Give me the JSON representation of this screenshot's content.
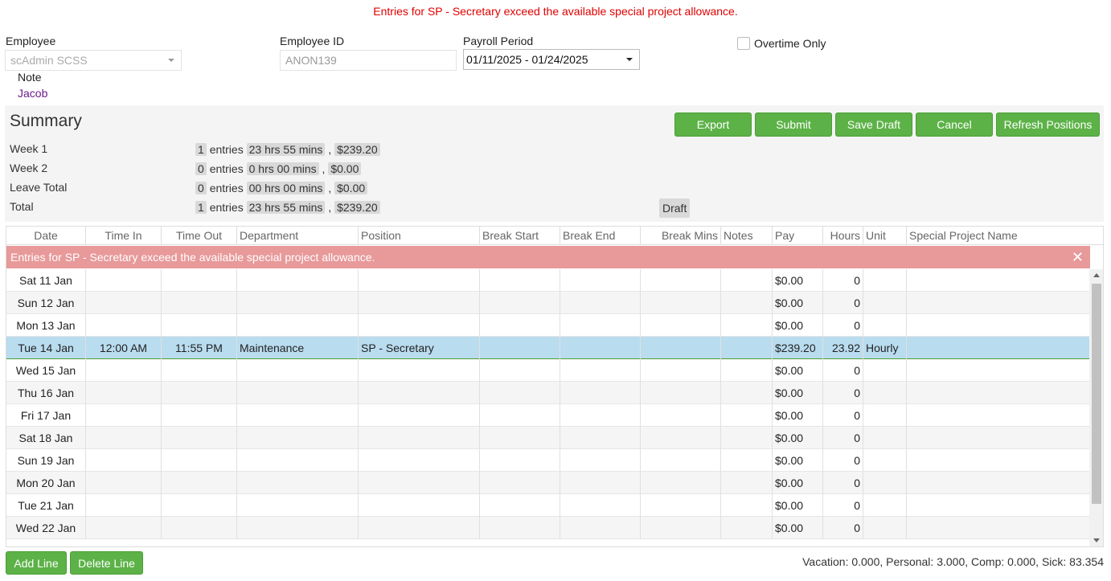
{
  "error_message": "Entries for SP - Secretary exceed the available special project allowance.",
  "form": {
    "employee_label": "Employee",
    "employee_value": "scAdmin SCSS",
    "employee_id_label": "Employee ID",
    "employee_id_value": "ANON139",
    "payroll_label": "Payroll Period",
    "payroll_value": "01/11/2025 - 01/24/2025",
    "overtime_label": "Overtime Only",
    "note_label": "Note",
    "note_value": "Jacob"
  },
  "summary": {
    "title": "Summary",
    "buttons": [
      "Export",
      "Submit",
      "Save Draft",
      "Cancel",
      "Refresh Positions"
    ],
    "rows": [
      {
        "label": "Week 1",
        "entries": "1",
        "entries_word": "entries",
        "hours": "23 hrs 55 mins",
        "amount": "$239.20"
      },
      {
        "label": "Week 2",
        "entries": "0",
        "entries_word": "entries",
        "hours": "0 hrs 00 mins",
        "amount": "$0.00"
      },
      {
        "label": "Leave Total",
        "entries": "0",
        "entries_word": "entries",
        "hours": "00 hrs 00 mins",
        "amount": "$0.00"
      },
      {
        "label": "Total",
        "entries": "1",
        "entries_word": "entries",
        "hours": "23 hrs 55 mins",
        "amount": "$239.20"
      }
    ],
    "status": "Draft"
  },
  "grid": {
    "columns": [
      "Date",
      "Time In",
      "Time Out",
      "Department",
      "Position",
      "Break Start",
      "Break End",
      "Break Mins",
      "Notes",
      "Pay",
      "Hours",
      "Unit",
      "Special Project Name"
    ],
    "rows": [
      {
        "date": "Sat 11 Jan",
        "time_in": "",
        "time_out": "",
        "department": "",
        "position": "",
        "pay": "$0.00",
        "hours": "0",
        "unit": ""
      },
      {
        "date": "Sun 12 Jan",
        "time_in": "",
        "time_out": "",
        "department": "",
        "position": "",
        "pay": "$0.00",
        "hours": "0",
        "unit": ""
      },
      {
        "date": "Mon 13 Jan",
        "time_in": "",
        "time_out": "",
        "department": "",
        "position": "",
        "pay": "$0.00",
        "hours": "0",
        "unit": ""
      },
      {
        "date": "Tue 14 Jan",
        "time_in": "12:00 AM",
        "time_out": "11:55 PM",
        "department": "Maintenance",
        "position": "SP - Secretary",
        "pay": "$239.20",
        "hours": "23.92",
        "unit": "Hourly"
      },
      {
        "date": "Wed 15 Jan",
        "time_in": "",
        "time_out": "",
        "department": "",
        "position": "",
        "pay": "$0.00",
        "hours": "0",
        "unit": ""
      },
      {
        "date": "Thu 16 Jan",
        "time_in": "",
        "time_out": "",
        "department": "",
        "position": "",
        "pay": "$0.00",
        "hours": "0",
        "unit": ""
      },
      {
        "date": "Fri 17 Jan",
        "time_in": "",
        "time_out": "",
        "department": "",
        "position": "",
        "pay": "$0.00",
        "hours": "0",
        "unit": ""
      },
      {
        "date": "Sat 18 Jan",
        "time_in": "",
        "time_out": "",
        "department": "",
        "position": "",
        "pay": "$0.00",
        "hours": "0",
        "unit": ""
      },
      {
        "date": "Sun 19 Jan",
        "time_in": "",
        "time_out": "",
        "department": "",
        "position": "",
        "pay": "$0.00",
        "hours": "0",
        "unit": ""
      },
      {
        "date": "Mon 20 Jan",
        "time_in": "",
        "time_out": "",
        "department": "",
        "position": "",
        "pay": "$0.00",
        "hours": "0",
        "unit": ""
      },
      {
        "date": "Tue 21 Jan",
        "time_in": "",
        "time_out": "",
        "department": "",
        "position": "",
        "pay": "$0.00",
        "hours": "0",
        "unit": ""
      },
      {
        "date": "Wed 22 Jan",
        "time_in": "",
        "time_out": "",
        "department": "",
        "position": "",
        "pay": "$0.00",
        "hours": "0",
        "unit": ""
      }
    ]
  },
  "footer": {
    "add_line": "Add Line",
    "delete_line": "Delete Line",
    "balances": "Vacation: 0.000, Personal: 3.000, Comp: 0.000, Sick: 83.354"
  },
  "colors": {
    "accent_green": "#5cb247",
    "error_red": "#e00000",
    "error_banner": "#e8999a",
    "selected_row": "#b9dcef"
  }
}
